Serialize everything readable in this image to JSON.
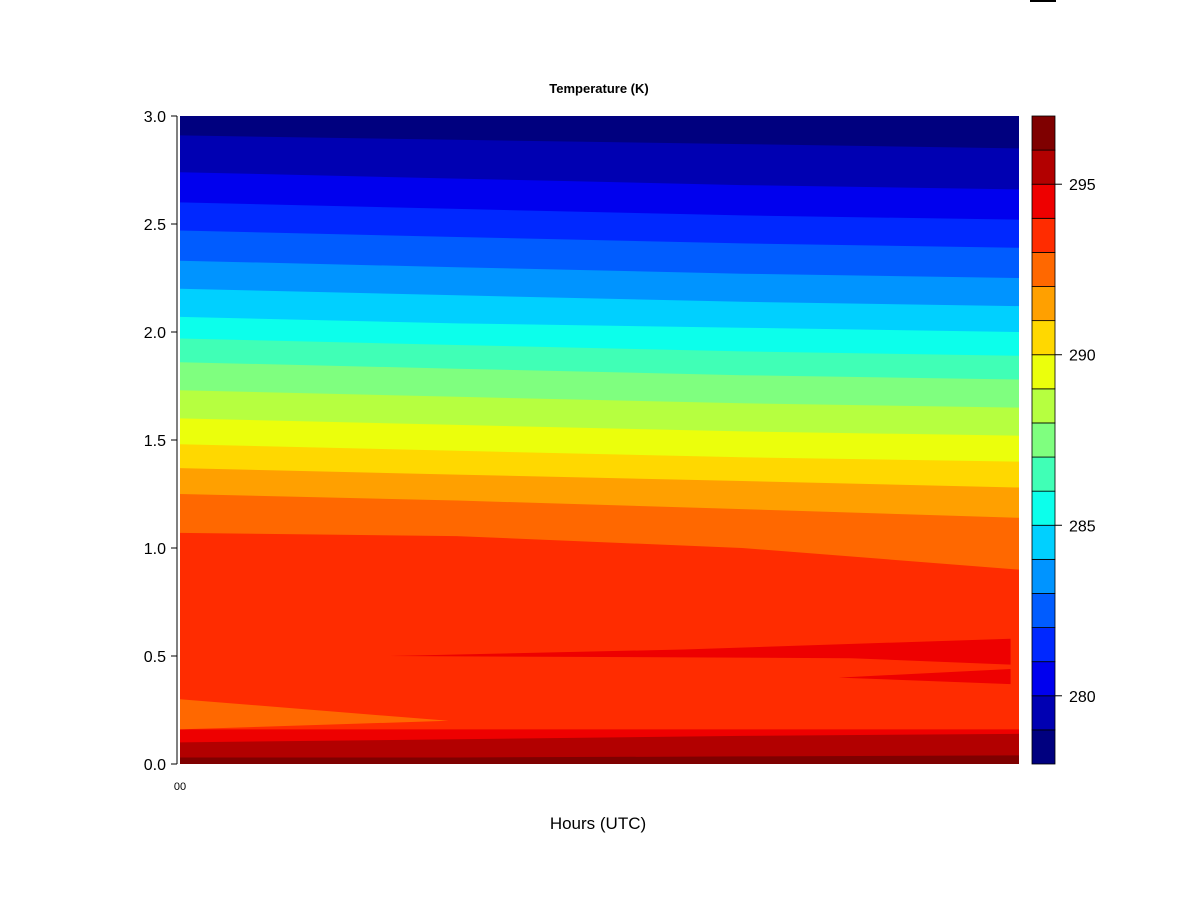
{
  "chart_data": {
    "type": "heatmap",
    "title": "Temperature (K)",
    "xlabel": "Hours (UTC)",
    "ylabel": "",
    "x_tick_labels": [
      "00"
    ],
    "ylim": [
      0,
      3
    ],
    "y_ticks": [
      "0.0",
      "0.5",
      "1.0",
      "1.5",
      "2.0",
      "2.5",
      "3.0"
    ],
    "colorbar": {
      "range": [
        278,
        297
      ],
      "tick_labels": [
        "280",
        "285",
        "290",
        "295"
      ],
      "levels": [
        {
          "lo": 278,
          "hi": 279,
          "color": "#00007f"
        },
        {
          "lo": 279,
          "hi": 280,
          "color": "#0000b2"
        },
        {
          "lo": 280,
          "hi": 281,
          "color": "#0000ee"
        },
        {
          "lo": 281,
          "hi": 282,
          "color": "#0028ff"
        },
        {
          "lo": 282,
          "hi": 283,
          "color": "#005cff"
        },
        {
          "lo": 283,
          "hi": 284,
          "color": "#0094ff"
        },
        {
          "lo": 284,
          "hi": 285,
          "color": "#00d0ff"
        },
        {
          "lo": 285,
          "hi": 286,
          "color": "#0cffeb"
        },
        {
          "lo": 286,
          "hi": 287,
          "color": "#40ffb6"
        },
        {
          "lo": 287,
          "hi": 288,
          "color": "#7fff7f"
        },
        {
          "lo": 288,
          "hi": 289,
          "color": "#b6ff40"
        },
        {
          "lo": 289,
          "hi": 290,
          "color": "#ebff0c"
        },
        {
          "lo": 290,
          "hi": 291,
          "color": "#ffd800"
        },
        {
          "lo": 291,
          "hi": 292,
          "color": "#ffa000"
        },
        {
          "lo": 292,
          "hi": 293,
          "color": "#ff6800"
        },
        {
          "lo": 293,
          "hi": 294,
          "color": "#ff2c00"
        },
        {
          "lo": 294,
          "hi": 295,
          "color": "#ee0000"
        },
        {
          "lo": 295,
          "hi": 296,
          "color": "#b20000"
        },
        {
          "lo": 296,
          "hi": 297,
          "color": "#7f0000"
        }
      ]
    },
    "bands": [
      {
        "level": 17,
        "upper": [
          0.03,
          0.03,
          0.035,
          0.04
        ]
      },
      {
        "level": 16,
        "upper": [
          0.1,
          0.115,
          0.13,
          0.14
        ]
      },
      {
        "level": 15,
        "upper": [
          0.16,
          0.16,
          0.16,
          0.16
        ]
      },
      {
        "level": 14,
        "upper": [
          1.07,
          1.055,
          1.0,
          0.9
        ]
      },
      {
        "level": 13,
        "upper": [
          1.25,
          1.22,
          1.18,
          1.14
        ]
      },
      {
        "level": 12,
        "upper": [
          1.37,
          1.34,
          1.31,
          1.28
        ]
      },
      {
        "level": 11,
        "upper": [
          1.48,
          1.45,
          1.42,
          1.4
        ]
      },
      {
        "level": 10,
        "upper": [
          1.6,
          1.57,
          1.54,
          1.52
        ]
      },
      {
        "level": 9,
        "upper": [
          1.73,
          1.7,
          1.67,
          1.65
        ]
      },
      {
        "level": 8,
        "upper": [
          1.86,
          1.83,
          1.8,
          1.78
        ]
      },
      {
        "level": 7,
        "upper": [
          1.97,
          1.94,
          1.91,
          1.89
        ]
      },
      {
        "level": 6,
        "upper": [
          2.07,
          2.04,
          2.02,
          2.0
        ]
      },
      {
        "level": 5,
        "upper": [
          2.2,
          2.17,
          2.14,
          2.12
        ]
      },
      {
        "level": 4,
        "upper": [
          2.33,
          2.3,
          2.27,
          2.25
        ]
      },
      {
        "level": 3,
        "upper": [
          2.47,
          2.44,
          2.41,
          2.39
        ]
      },
      {
        "level": 2,
        "upper": [
          2.6,
          2.57,
          2.54,
          2.52
        ]
      },
      {
        "level": 1,
        "upper": [
          2.74,
          2.71,
          2.68,
          2.66
        ]
      },
      {
        "level": 0,
        "upper": [
          2.91,
          2.89,
          2.87,
          2.85
        ]
      }
    ],
    "band_x": [
      0,
      0.33,
      0.67,
      1
    ],
    "features": [
      {
        "level": 14,
        "points": [
          [
            0,
            0.16
          ],
          [
            0,
            0.3
          ],
          [
            0.32,
            0.2
          ],
          [
            0,
            0.16
          ]
        ]
      },
      {
        "level": 16,
        "points": [
          [
            0.25,
            0.5
          ],
          [
            0.6,
            0.53
          ],
          [
            0.99,
            0.58
          ],
          [
            0.99,
            0.46
          ],
          [
            0.8,
            0.49
          ]
        ]
      },
      {
        "level": 16,
        "points": [
          [
            0.785,
            0.4
          ],
          [
            0.99,
            0.44
          ],
          [
            0.99,
            0.37
          ]
        ]
      }
    ]
  }
}
